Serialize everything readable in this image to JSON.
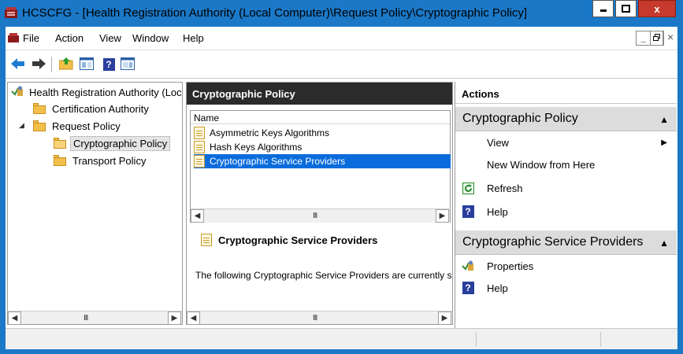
{
  "window": {
    "title": "HCSCFG - [Health Registration Authority (Local Computer)\\Request Policy\\Cryptographic Policy]",
    "minimize_icon": "minimize-icon",
    "maximize_icon": "maximize-icon",
    "close_label": "x",
    "accent_color": "#1b78c7",
    "close_color": "#c7392c"
  },
  "menu": {
    "items": [
      "File",
      "Action",
      "View",
      "Window",
      "Help"
    ],
    "mdi": {
      "minimize": "_",
      "restore": "restore-icon",
      "close": "×"
    }
  },
  "toolbar": {
    "icons": [
      "back-arrow-icon",
      "forward-arrow-icon",
      "up-folder-icon",
      "show-hide-console-tree-icon",
      "help-icon",
      "show-hide-action-pane-icon"
    ]
  },
  "tree": {
    "root": "Health Registration Authority (Local Computer)",
    "items": [
      {
        "label": "Certification Authority"
      },
      {
        "label": "Request Policy",
        "expanded": true
      },
      {
        "label": "Cryptographic Policy",
        "selected": true
      },
      {
        "label": "Transport Policy"
      }
    ],
    "scroll_grip": "III"
  },
  "middle": {
    "header": "Cryptographic Policy",
    "column": "Name",
    "rows": [
      {
        "label": "Asymmetric Keys Algorithms"
      },
      {
        "label": "Hash Keys Algorithms"
      },
      {
        "label": "Cryptographic Service Providers",
        "selected": true
      }
    ],
    "scroll_grip": "III",
    "description_title": "Cryptographic Service Providers",
    "description_text": "The following Cryptographic Service Providers are currently supported",
    "selection_color": "#0a6cdc"
  },
  "actions": {
    "header": "Actions",
    "group1": {
      "title": "Cryptographic Policy",
      "items": [
        {
          "label": "View",
          "submenu": true
        },
        {
          "label": "New Window from Here"
        },
        {
          "label": "Refresh",
          "icon": "refresh-icon"
        },
        {
          "label": "Help",
          "icon": "help-icon"
        }
      ]
    },
    "group2": {
      "title": "Cryptographic Service Providers",
      "items": [
        {
          "label": "Properties",
          "icon": "properties-icon"
        },
        {
          "label": "Help",
          "icon": "help-icon"
        }
      ]
    }
  }
}
